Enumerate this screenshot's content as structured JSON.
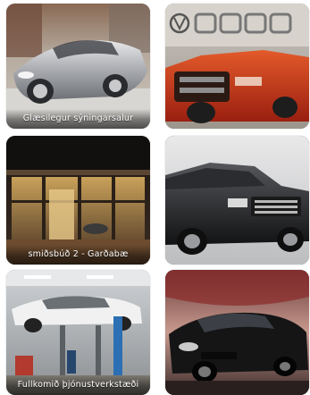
{
  "tiles": [
    {
      "caption": "Glæsilegur sýningarsalur"
    },
    {
      "caption": ""
    },
    {
      "caption": "smiðsbúð 2 - Garðabæ"
    },
    {
      "caption": ""
    },
    {
      "caption": "Fullkomið þjónustverkstæði"
    },
    {
      "caption": ""
    }
  ]
}
